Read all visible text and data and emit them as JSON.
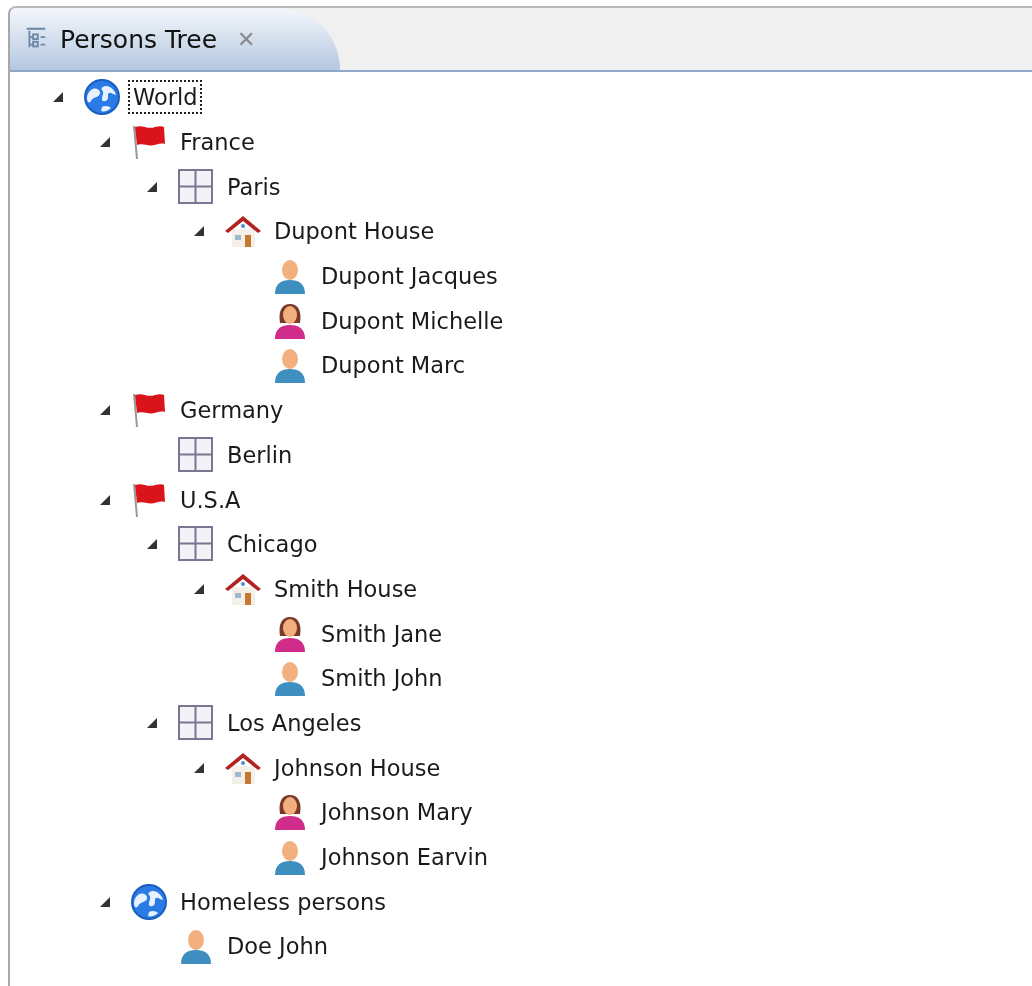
{
  "tab": {
    "title": "Persons Tree",
    "close": "✕"
  },
  "tree": [
    {
      "label": "World",
      "kind": "world",
      "selected": true,
      "expanded": true,
      "children": [
        {
          "label": "France",
          "kind": "country",
          "selected": false,
          "expanded": true,
          "children": [
            {
              "label": "Paris",
              "kind": "city",
              "selected": false,
              "expanded": true,
              "children": [
                {
                  "label": "Dupont House",
                  "kind": "house",
                  "selected": false,
                  "expanded": true,
                  "children": [
                    {
                      "label": "Dupont Jacques",
                      "kind": "man",
                      "selected": false
                    },
                    {
                      "label": "Dupont Michelle",
                      "kind": "woman",
                      "selected": false
                    },
                    {
                      "label": "Dupont Marc",
                      "kind": "man",
                      "selected": false
                    }
                  ]
                }
              ]
            }
          ]
        },
        {
          "label": "Germany",
          "kind": "country",
          "selected": false,
          "expanded": true,
          "children": [
            {
              "label": "Berlin",
              "kind": "city",
              "selected": false
            }
          ]
        },
        {
          "label": "U.S.A",
          "kind": "country",
          "selected": false,
          "expanded": true,
          "children": [
            {
              "label": "Chicago",
              "kind": "city",
              "selected": false,
              "expanded": true,
              "children": [
                {
                  "label": "Smith House",
                  "kind": "house",
                  "selected": false,
                  "expanded": true,
                  "children": [
                    {
                      "label": "Smith Jane",
                      "kind": "woman",
                      "selected": false
                    },
                    {
                      "label": "Smith John",
                      "kind": "man",
                      "selected": false
                    }
                  ]
                }
              ]
            },
            {
              "label": "Los Angeles",
              "kind": "city",
              "selected": false,
              "expanded": true,
              "children": [
                {
                  "label": "Johnson House",
                  "kind": "house",
                  "selected": false,
                  "expanded": true,
                  "children": [
                    {
                      "label": "Johnson Mary",
                      "kind": "woman",
                      "selected": false
                    },
                    {
                      "label": "Johnson Earvin",
                      "kind": "man",
                      "selected": false
                    }
                  ]
                }
              ]
            }
          ]
        },
        {
          "label": "Homeless persons",
          "kind": "world",
          "selected": false,
          "expanded": true,
          "children": [
            {
              "label": "Doe John",
              "kind": "man",
              "selected": false
            }
          ]
        }
      ]
    }
  ]
}
